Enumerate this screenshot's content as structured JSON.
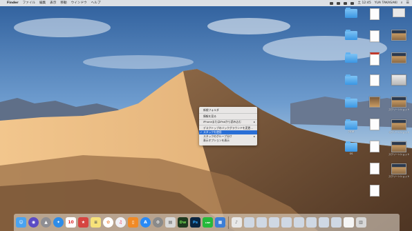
{
  "menubar": {
    "app_name": "Finder",
    "menus": [
      "ファイル",
      "編集",
      "表示",
      "移動",
      "ウインドウ",
      "ヘルプ"
    ],
    "clock": "土 12:45",
    "user": "YUA TAKASAKI"
  },
  "context_menu": {
    "items": [
      {
        "label": "新規フォルダ"
      },
      {
        "label": "情報を見る"
      },
      {
        "label": "iPhoneまたはiPadから読み込む",
        "submenu": true
      },
      {
        "label": "デスクトップのバックグラウンドを変更..."
      },
      {
        "label": "スタックを使用",
        "checked": true,
        "selected": true
      },
      {
        "label": "スタックのグループ分け",
        "submenu": true
      },
      {
        "label": "表示オプションを表示"
      }
    ]
  },
  "desktop_icons": [
    {
      "kind": "folder",
      "label": ""
    },
    {
      "kind": "folder",
      "label": ""
    },
    {
      "kind": "folder",
      "label": ""
    },
    {
      "kind": "folder",
      "label": ""
    },
    {
      "kind": "folder",
      "label": ""
    },
    {
      "kind": "folder",
      "label": "2018"
    },
    {
      "kind": "folder",
      "label": "OS"
    },
    {
      "kind": "screenshot",
      "label": "スクリーンショット 2018-10...12.48.09"
    },
    {
      "kind": "screenshot",
      "label": "スクリーンショット 2018-10...12.48.37"
    },
    {
      "kind": "screenshot",
      "label": "スクリーンショット 2018-10...12.48.55"
    },
    {
      "kind": "screenshot",
      "label": "スクリーンショット 2018-10...12.48.71"
    }
  ],
  "dock": {
    "apps": [
      {
        "name": "finder-icon",
        "bg": "#4aa3f0",
        "glyph": "☺"
      },
      {
        "name": "siri-icon",
        "bg": "#5b4bc4",
        "glyph": "◉"
      },
      {
        "name": "launchpad-icon",
        "bg": "#8e8e93",
        "glyph": "🚀"
      },
      {
        "name": "safari-icon",
        "bg": "#2d8ce8",
        "glyph": "✦"
      },
      {
        "name": "calendar-icon",
        "bg": "#ffffff",
        "glyph": "10"
      },
      {
        "name": "wunderlist-icon",
        "bg": "#d64541",
        "glyph": "★"
      },
      {
        "name": "notes-icon",
        "bg": "#f7e27a",
        "glyph": "≡"
      },
      {
        "name": "photos-icon",
        "bg": "#ffffff",
        "glyph": "✿"
      },
      {
        "name": "itunes-icon",
        "bg": "#f0f0f5",
        "glyph": "♫"
      },
      {
        "name": "books-icon",
        "bg": "#f08a26",
        "glyph": "📖"
      },
      {
        "name": "app-store-icon",
        "bg": "#2a8af5",
        "glyph": "A"
      },
      {
        "name": "system-preferences-icon",
        "bg": "#8a8a8a",
        "glyph": "⚙"
      },
      {
        "name": "keynote-icon",
        "bg": "#d9d9d9",
        "glyph": "▤"
      },
      {
        "name": "dreamweaver-icon",
        "bg": "#1f3a1f",
        "glyph": "Dw"
      },
      {
        "name": "photoshop-icon",
        "bg": "#0a2540",
        "glyph": "Ps"
      },
      {
        "name": "line-icon",
        "bg": "#25b93b",
        "glyph": "LINE"
      },
      {
        "name": "preview-icon",
        "bg": "#3c7ed6",
        "glyph": "▦"
      }
    ],
    "stacks": [
      {
        "name": "music-stack-icon",
        "bg": "#e8e8e8",
        "glyph": "♪"
      },
      {
        "name": "screenshot-stack-icon",
        "bg": "#cfd8e4",
        "glyph": ""
      },
      {
        "name": "screenshot-stack-icon",
        "bg": "#cfd8e4",
        "glyph": ""
      },
      {
        "name": "screenshot-stack-icon",
        "bg": "#cfd8e4",
        "glyph": ""
      },
      {
        "name": "screenshot-stack-icon",
        "bg": "#cfd8e4",
        "glyph": ""
      },
      {
        "name": "screenshot-stack-icon",
        "bg": "#cfd8e4",
        "glyph": ""
      },
      {
        "name": "screenshot-stack-icon",
        "bg": "#cfd8e4",
        "glyph": ""
      },
      {
        "name": "screenshot-stack-icon",
        "bg": "#cfd8e4",
        "glyph": ""
      },
      {
        "name": "screenshot-stack-icon",
        "bg": "#cfd8e4",
        "glyph": ""
      },
      {
        "name": "document-stack-icon",
        "bg": "#f5f5f5",
        "glyph": ""
      },
      {
        "name": "trash-icon",
        "bg": "#d8d8d8",
        "glyph": "🗑"
      }
    ]
  },
  "colors": {
    "selection": "#2a6fd6",
    "menubar": "#ececec"
  }
}
